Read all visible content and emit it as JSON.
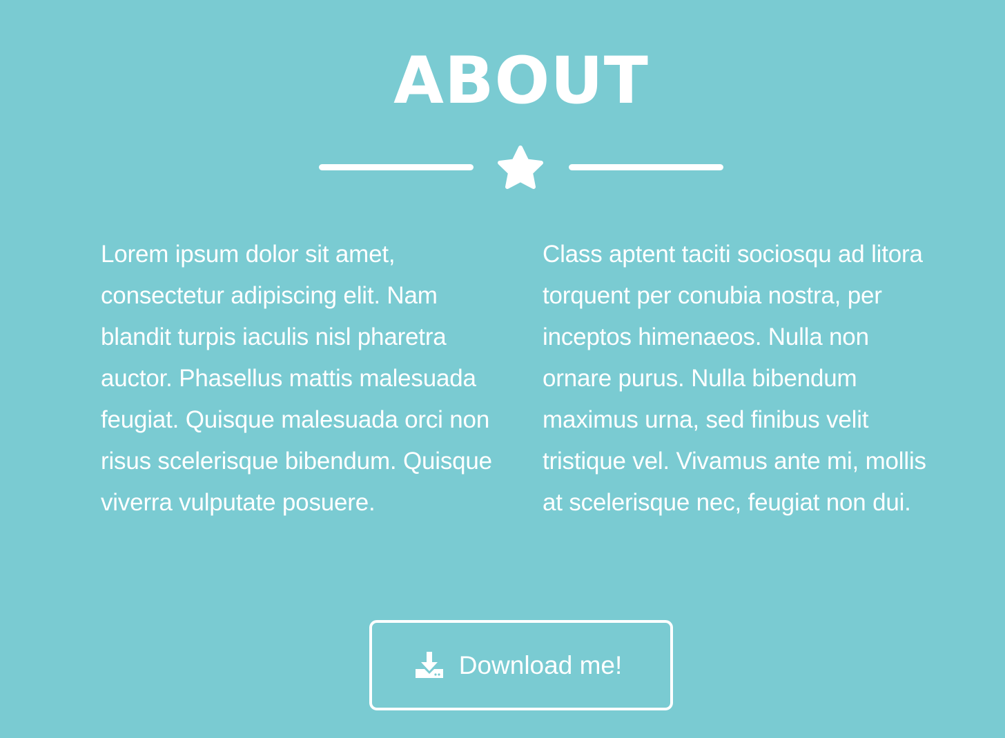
{
  "section": {
    "title": "ABOUT",
    "divider_icon": "star-icon",
    "paragraph_left": "Lorem ipsum dolor sit amet, consectetur adipiscing elit. Nam blandit turpis iaculis nisl pharetra auctor. Phasellus mattis malesuada feugiat. Quisque malesuada orci non risus scelerisque bibendum. Quisque viverra vulputate posuere.",
    "paragraph_right": "Class aptent taciti sociosqu ad litora torquent per conubia nostra, per inceptos himenaeos. Nulla non ornare purus. Nulla bibendum maximus urna, sed finibus velit tristique vel. Vivamus ante mi, mollis at scelerisque nec, feugiat non dui."
  },
  "download_button": {
    "label": "Download me!",
    "icon": "download-icon"
  },
  "colors": {
    "background": "#7acbd2",
    "foreground": "#ffffff"
  }
}
